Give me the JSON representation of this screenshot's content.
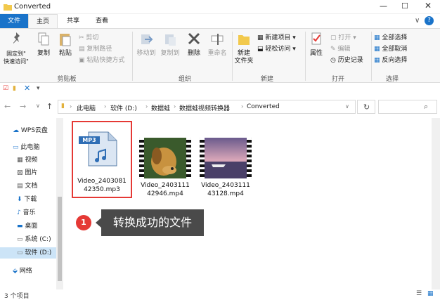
{
  "window": {
    "title": "Converted"
  },
  "menu": {
    "tabs": [
      "文件",
      "主页",
      "共享",
      "查看"
    ]
  },
  "ribbon": {
    "clipboard": {
      "pin": "固定到\"\n快速访问\"",
      "copy": "复制",
      "paste": "粘贴",
      "cut": "剪切",
      "copy_path": "复制路径",
      "paste_shortcut": "粘贴快捷方式",
      "label": "剪贴板"
    },
    "organize": {
      "move_to": "移动到",
      "copy_to": "复制到",
      "delete": "删除",
      "rename": "重命名",
      "label": "组织"
    },
    "new": {
      "new_folder": "新建\n文件夹",
      "new_item": "新建项目",
      "easy_access": "轻松访问",
      "label": "新建"
    },
    "open": {
      "properties": "属性",
      "open": "打开",
      "edit": "编辑",
      "history": "历史记录",
      "label": "打开"
    },
    "select": {
      "select_all": "全部选择",
      "select_none": "全部取消",
      "invert": "反向选择",
      "label": "选择"
    }
  },
  "address": {
    "crumbs": [
      "此电脑",
      "软件 (D:)",
      "数据蛙",
      "数据蛙视频转换器",
      "Converted"
    ]
  },
  "nav": {
    "items": [
      "WPS云盘",
      "此电脑",
      "视频",
      "图片",
      "文档",
      "下载",
      "音乐",
      "桌面",
      "系统 (C:)",
      "软件 (D:)",
      "网络"
    ]
  },
  "files": [
    {
      "name": "Video_2403081\n42350.mp3",
      "type": "mp3",
      "badge": "MP3"
    },
    {
      "name": "Video_2403111\n42946.mp4",
      "type": "video"
    },
    {
      "name": "Video_2403111\n43128.mp4",
      "type": "video"
    }
  ],
  "callout": {
    "number": "1",
    "text": "转换成功的文件"
  },
  "status": {
    "count": "3 个项目"
  },
  "colors": {
    "accent": "#1a73c9",
    "highlight": "#e53935",
    "callout_bg": "#4a4a4a"
  }
}
